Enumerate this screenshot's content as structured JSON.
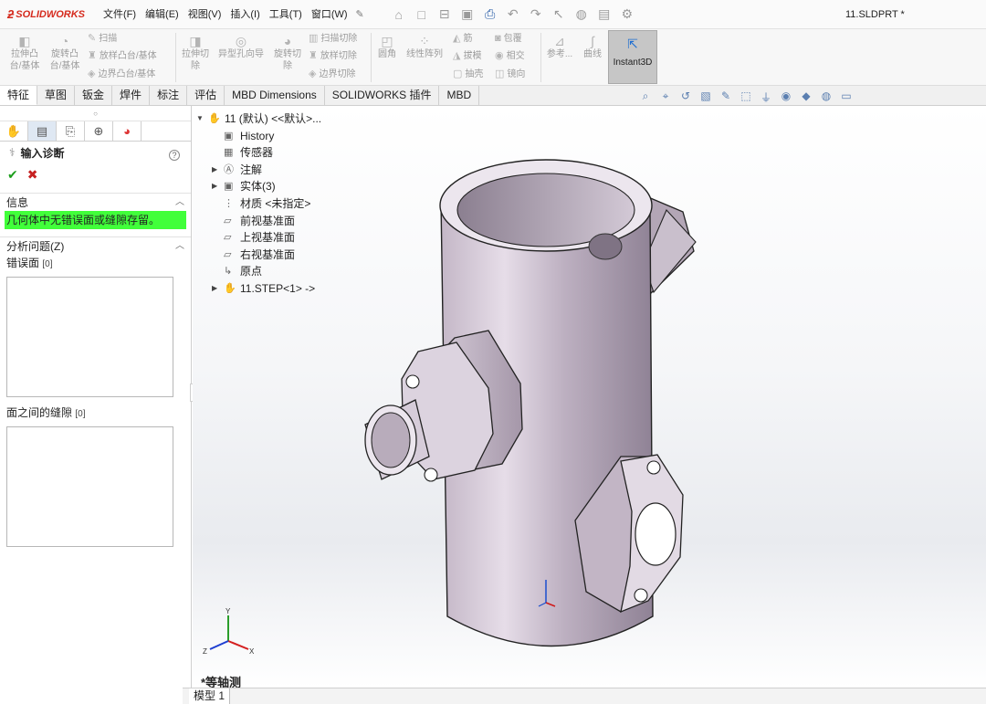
{
  "app": {
    "logo_text": "SOLIDWORKS",
    "doc_title": "11.SLDPRT *"
  },
  "menus": [
    "文件(F)",
    "编辑(E)",
    "视图(V)",
    "插入(I)",
    "工具(T)",
    "窗口(W)"
  ],
  "ribbon": {
    "extrude_boss_1": "拉伸凸",
    "extrude_boss_2": "台/基体",
    "revolve_boss_1": "旋转凸",
    "revolve_boss_2": "台/基体",
    "sweep": "扫描",
    "loft_boss": "放样凸台/基体",
    "boundary_boss": "边界凸台/基体",
    "extrude_cut_1": "拉伸切",
    "extrude_cut_2": "除",
    "hole_wizard": "异型孔向导",
    "revolve_cut_1": "旋转切",
    "revolve_cut_2": "除",
    "sweep_cut": "扫描切除",
    "loft_cut": "放样切除",
    "boundary_cut": "边界切除",
    "fillet": "圆角",
    "linear_pattern": "线性阵列",
    "rib": "筋",
    "draft": "拔模",
    "shell": "抽壳",
    "wrap": "包覆",
    "intersect": "相交",
    "mirror": "镜向",
    "reference": "参考...",
    "curves": "曲线",
    "instant3d": "Instant3D"
  },
  "tabs": [
    "特征",
    "草图",
    "钣金",
    "焊件",
    "标注",
    "评估",
    "MBD Dimensions",
    "SOLIDWORKS 插件",
    "MBD"
  ],
  "property_manager": {
    "title": "输入诊断",
    "info_header": "信息",
    "info_message": "几何体中无错误面或缝隙存留。",
    "analyze_header": "分析问题(Z)",
    "faulty_faces_label": "错误面",
    "faulty_faces_count": "[0]",
    "gaps_label": "面之间的缝隙",
    "gaps_count": "[0]"
  },
  "tree": {
    "root": "11 (默认) <<默认>...",
    "items": [
      "History",
      "传感器",
      "注解",
      "实体(3)",
      "材质 <未指定>",
      "前视基准面",
      "上视基准面",
      "右视基准面",
      "原点",
      "11.STEP<1> ->"
    ]
  },
  "viewport": {
    "view_name": "*等轴测",
    "triad_x": "X",
    "triad_y": "Y",
    "triad_z": "Z"
  },
  "bottom_tab": "模型 1"
}
